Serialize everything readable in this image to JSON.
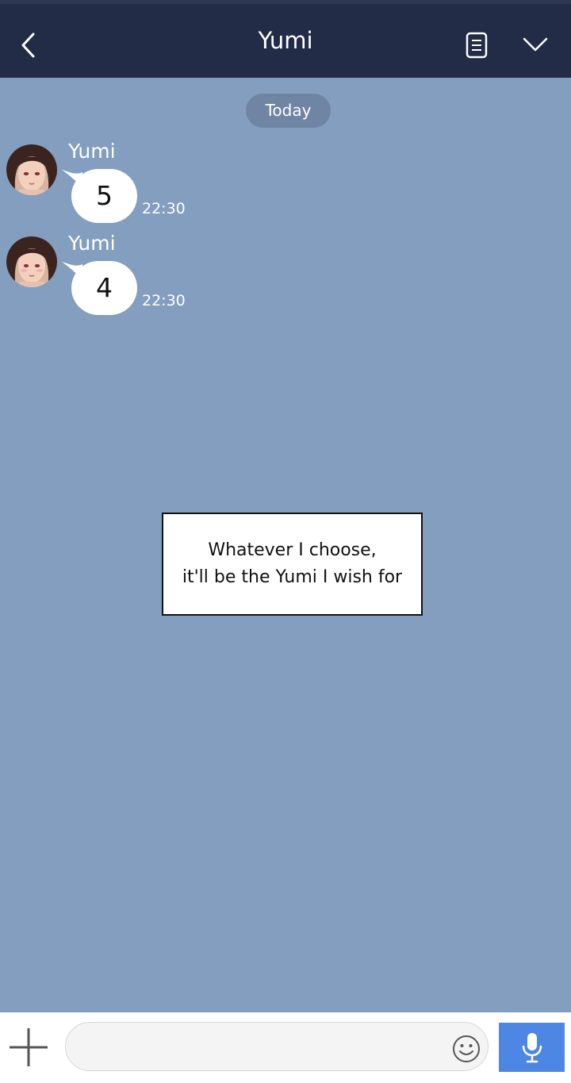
{
  "header": {
    "title": "Yumi",
    "back_icon": "chevron-left-icon",
    "menu_icon": "document-icon",
    "dropdown_icon": "chevron-down-icon"
  },
  "date_divider": "Today",
  "messages": [
    {
      "sender": "Yumi",
      "text": "5",
      "time": "22:30"
    },
    {
      "sender": "Yumi",
      "text": "4",
      "time": "22:30"
    }
  ],
  "caption": {
    "line1": "Whatever I choose,",
    "line2": "it'll be the Yumi I wish for"
  },
  "composer": {
    "input_value": "",
    "attach_icon": "plus-icon",
    "emoji_icon": "smiley-icon",
    "voice_icon": "microphone-icon"
  },
  "colors": {
    "header_bg": "#232c46",
    "chat_bg": "#839ebf",
    "date_pill_bg": "#6f85a3",
    "mic_button_bg": "#4e86e4"
  }
}
